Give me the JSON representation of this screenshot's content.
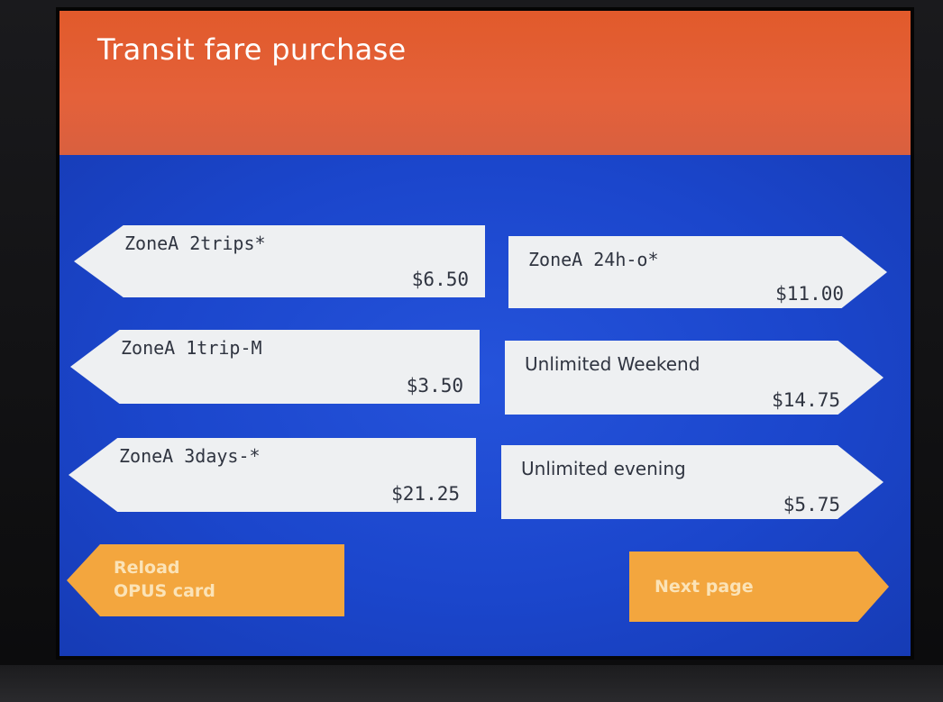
{
  "header": {
    "title": "Transit fare purchase"
  },
  "fares": [
    {
      "name": "ZoneA 2trips*",
      "price": "$6.50"
    },
    {
      "name": "ZoneA 24h-o*",
      "price": "$11.00"
    },
    {
      "name": "ZoneA 1trip-M",
      "price": "$3.50"
    },
    {
      "name": "Unlimited Weekend",
      "price": "$14.75"
    },
    {
      "name": "ZoneA 3days-*",
      "price": "$21.25"
    },
    {
      "name": "Unlimited evening",
      "price": "$5.75"
    }
  ],
  "actions": {
    "reload_line1": "Reload",
    "reload_line2": "OPUS card",
    "next_page": "Next page"
  },
  "colors": {
    "header": "#e15a2b",
    "background": "#1a44c9",
    "fare_button": "#eef0f2",
    "action_button": "#f3a63e",
    "action_text": "#fbe3b7"
  }
}
